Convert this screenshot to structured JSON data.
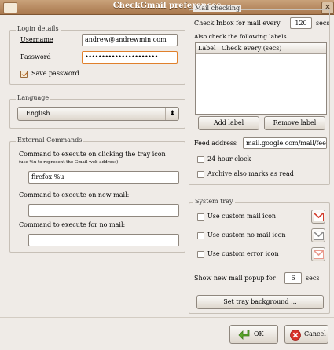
{
  "window": {
    "title": "CheckGmail preferences",
    "close_glyph": "✕"
  },
  "login": {
    "legend": "Login details",
    "username_label": "Username",
    "username_value": "andrew@andrewmin.com",
    "password_label": "Password",
    "password_value": "••••••••••••••••••••••",
    "save_password_label": "Save password",
    "save_password_checked": true
  },
  "language": {
    "legend": "Language",
    "selected": "English",
    "spin_glyph": "⬍"
  },
  "external": {
    "legend": "External Commands",
    "tray_click_label": "Command to execute on clicking the tray icon",
    "tray_click_hint": "(use %u to represent the Gmail web address)",
    "tray_click_value": "firefox %u",
    "new_mail_label": "Command to execute on new mail:",
    "new_mail_value": "",
    "no_mail_label": "Command to execute for no mail:",
    "no_mail_value": ""
  },
  "mail_checking": {
    "legend": "Mail checking",
    "check_inbox_label": "Check Inbox for mail every",
    "check_inbox_value": "120",
    "check_inbox_unit": "secs",
    "labels_intro": "Also check the following labels",
    "columns": [
      "Label",
      "Check every (secs)"
    ],
    "add_label_button": "Add label",
    "remove_label_button": "Remove label",
    "feed_address_label": "Feed address",
    "feed_address_value": "mail.google.com/mail/feed/atom",
    "clock_24_label": "24 hour clock",
    "clock_24_checked": false,
    "archive_label": "Archive also marks as read",
    "archive_checked": false
  },
  "system_tray": {
    "legend": "System tray",
    "custom_mail_label": "Use custom mail icon",
    "custom_no_mail_label": "Use custom no mail icon",
    "custom_error_label": "Use custom error icon",
    "popup_label": "Show new mail popup for",
    "popup_value": "6",
    "popup_unit": "secs",
    "tray_bg_button": "Set tray background ...",
    "colors": {
      "mail": "#d23b2b",
      "no_mail": "#8c8c8c",
      "error": "#e99a8e"
    }
  },
  "footer": {
    "ok_label": "OK",
    "cancel_label": "Cancel"
  }
}
